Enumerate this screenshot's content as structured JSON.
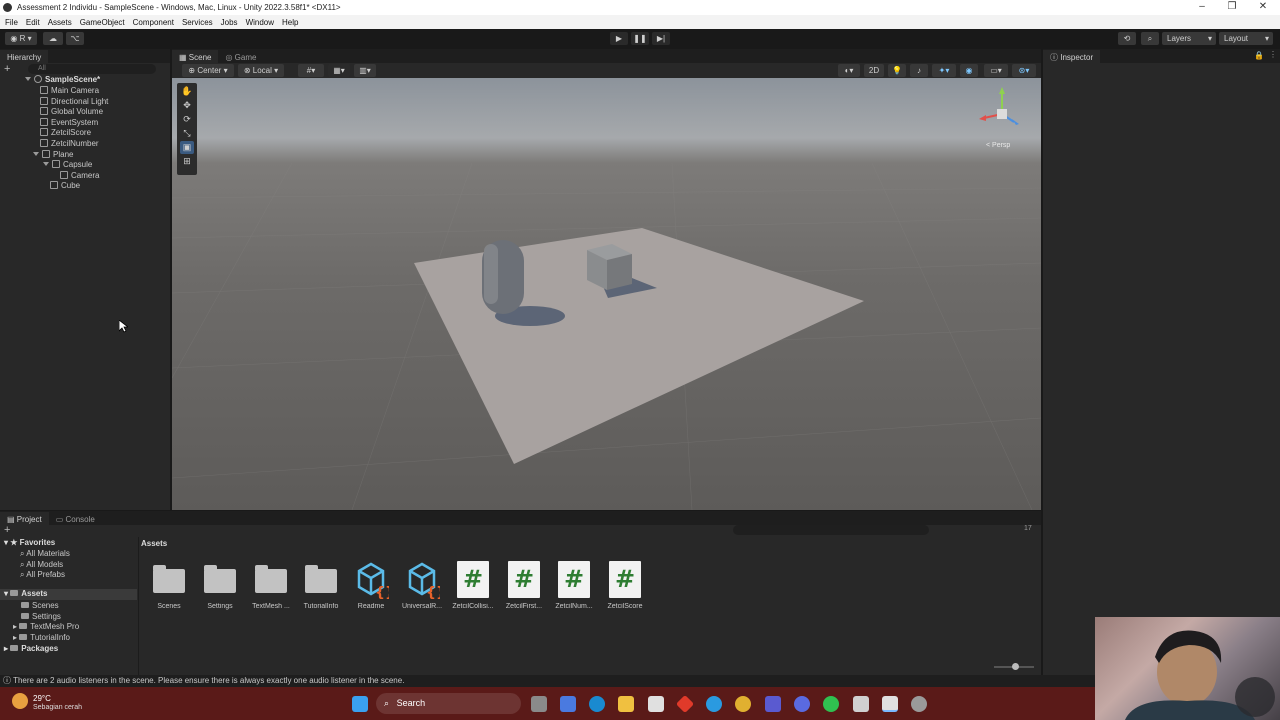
{
  "window": {
    "title": "Assessment 2 Individu - SampleScene - Windows, Mac, Linux - Unity 2022.3.58f1* <DX11>"
  },
  "menu": [
    "File",
    "Edit",
    "Assets",
    "GameObject",
    "Component",
    "Services",
    "Jobs",
    "Window",
    "Help"
  ],
  "toolbar": {
    "account_label": "R",
    "layers_label": "Layers",
    "layout_label": "Layout"
  },
  "hierarchy": {
    "tab_label": "Hierarchy",
    "search_placeholder": "All",
    "scene_name": "SampleScene*",
    "items": [
      "Main Camera",
      "Directional Light",
      "Global Volume",
      "EventSystem",
      "ZetcilScore",
      "ZetcilNumber",
      "Plane",
      "Capsule",
      "Camera",
      "Cube"
    ]
  },
  "scene": {
    "tabs": [
      "Scene",
      "Game"
    ],
    "pivot_mode": "Center",
    "pivot_rotation": "Local",
    "mode_2d": "2D",
    "gizmo_persp": "< Persp"
  },
  "inspector": {
    "tab_label": "Inspector"
  },
  "project": {
    "tabs": [
      "Project",
      "Console"
    ],
    "favorites_label": "Favorites",
    "favorites": [
      "All Materials",
      "All Models",
      "All Prefabs"
    ],
    "assets_label": "Assets",
    "asset_folders": [
      "Scenes",
      "Settings",
      "TextMesh Pro",
      "TutorialInfo"
    ],
    "packages_label": "Packages",
    "breadcrumb": "Assets",
    "hidden_count": "17",
    "grid_items": [
      {
        "label": "Scenes",
        "icon": "folder-icon"
      },
      {
        "label": "Settings",
        "icon": "folder-icon"
      },
      {
        "label": "TextMesh ...",
        "icon": "folder-icon"
      },
      {
        "label": "TutorialInfo",
        "icon": "folder-icon"
      },
      {
        "label": "Readme",
        "icon": "readme-asset-icon"
      },
      {
        "label": "UniversalR...",
        "icon": "render-pipeline-asset-icon"
      },
      {
        "label": "ZetcilCollisi...",
        "icon": "csharp-script-icon"
      },
      {
        "label": "ZetcilFirst...",
        "icon": "csharp-script-icon"
      },
      {
        "label": "ZetcilNum...",
        "icon": "csharp-script-icon"
      },
      {
        "label": "ZetcilScore",
        "icon": "csharp-script-icon"
      }
    ]
  },
  "status": {
    "message": "There are 2 audio listeners in the scene. Please ensure there is always exactly one audio listener in the scene."
  },
  "taskbar": {
    "weather_temp": "29°C",
    "weather_desc": "Sebagian cerah",
    "search_label": "Search"
  },
  "colors": {
    "script_hash": "#2e7d32",
    "asset_icon_blue": "#5bbbe8",
    "asset_icon_orange": "#e8622a",
    "taskbar_bg": "#5a1a18"
  }
}
